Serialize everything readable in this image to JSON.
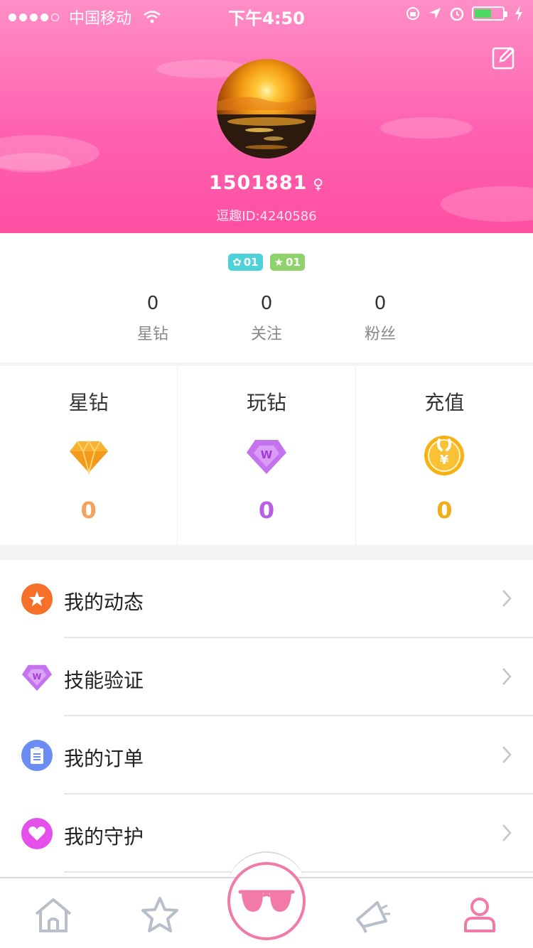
{
  "status_bar": {
    "carrier": "中国移动",
    "time": "下午4:50"
  },
  "profile": {
    "username": "1501881",
    "gender_symbol": "♀",
    "user_id": "逗趣ID:4240586",
    "badges": [
      {
        "label": "01",
        "color": "#4dd2d9"
      },
      {
        "label": "01",
        "color": "#8fd16a"
      }
    ]
  },
  "stats": [
    {
      "value": "0",
      "label": "星钻"
    },
    {
      "value": "0",
      "label": "关注"
    },
    {
      "value": "0",
      "label": "粉丝"
    }
  ],
  "wallet": [
    {
      "title": "星钻",
      "value": "0",
      "color": "#f5a25d",
      "icon": "gold-diamond-icon"
    },
    {
      "title": "玩钻",
      "value": "0",
      "color": "#b85de8",
      "icon": "purple-diamond-icon"
    },
    {
      "title": "充值",
      "value": "0",
      "color": "#f2ad1a",
      "icon": "recharge-coin-icon"
    }
  ],
  "menu": [
    {
      "label": "我的动态",
      "icon": "star-icon",
      "color": "#f6702a"
    },
    {
      "label": "技能验证",
      "icon": "purple-diamond-icon",
      "color": "#c163e8"
    },
    {
      "label": "我的订单",
      "icon": "clipboard-icon",
      "color": "#6b8cf2"
    },
    {
      "label": "我的守护",
      "icon": "heart-icon",
      "color": "#e54fea"
    }
  ],
  "tabs": [
    "home-icon",
    "star-icon",
    "sunglasses-icon",
    "megaphone-icon",
    "profile-icon"
  ]
}
